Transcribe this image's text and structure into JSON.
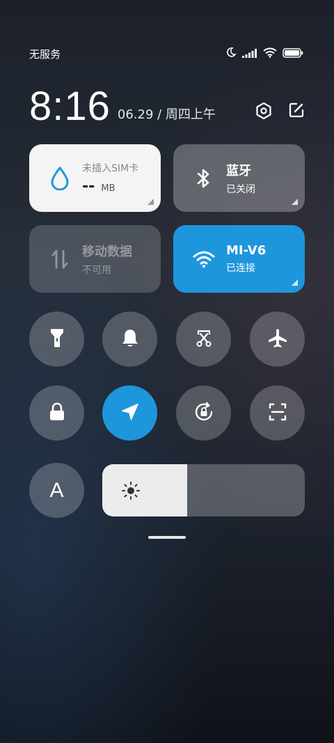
{
  "status_bar": {
    "carrier": "无服务",
    "icons": [
      "moon-icon",
      "signal-icon",
      "wifi-icon",
      "battery-icon"
    ]
  },
  "header": {
    "time": "8:16",
    "date": "06.29 / 周四上午",
    "icons": [
      "settings-icon",
      "edit-icon"
    ]
  },
  "tiles": {
    "data_usage": {
      "title": "未插入SIM卡",
      "value": "--",
      "unit": "MB",
      "icon": "water-drop-icon"
    },
    "bluetooth": {
      "title": "蓝牙",
      "status": "已关闭",
      "icon": "bluetooth-icon"
    },
    "mobile_data": {
      "title": "移动数据",
      "status": "不可用",
      "icon": "data-arrows-icon"
    },
    "wifi": {
      "title": "MI-V6",
      "status": "已连接",
      "icon": "wifi-icon"
    }
  },
  "toggles": [
    {
      "name": "flashlight",
      "icon": "flashlight-icon",
      "active": false
    },
    {
      "name": "ringer",
      "icon": "bell-icon",
      "active": false
    },
    {
      "name": "screenshot",
      "icon": "scissors-icon",
      "active": false
    },
    {
      "name": "airplane-mode",
      "icon": "airplane-icon",
      "active": false
    },
    {
      "name": "lock-screen",
      "icon": "lock-icon",
      "active": false
    },
    {
      "name": "location",
      "icon": "location-arrow-icon",
      "active": true
    },
    {
      "name": "rotation-lock",
      "icon": "rotation-lock-icon",
      "active": false
    },
    {
      "name": "scanner",
      "icon": "scan-icon",
      "active": false
    },
    {
      "name": "auto-brightness",
      "icon": "letter-a-icon",
      "label": "A",
      "active": false
    }
  ],
  "brightness": {
    "level": 0.42,
    "icon": "sun-icon"
  },
  "colors": {
    "accent": "#1e96dc",
    "tile_light": "#f4f4f4",
    "tile_dark": "rgba(255,255,255,0.28)"
  }
}
